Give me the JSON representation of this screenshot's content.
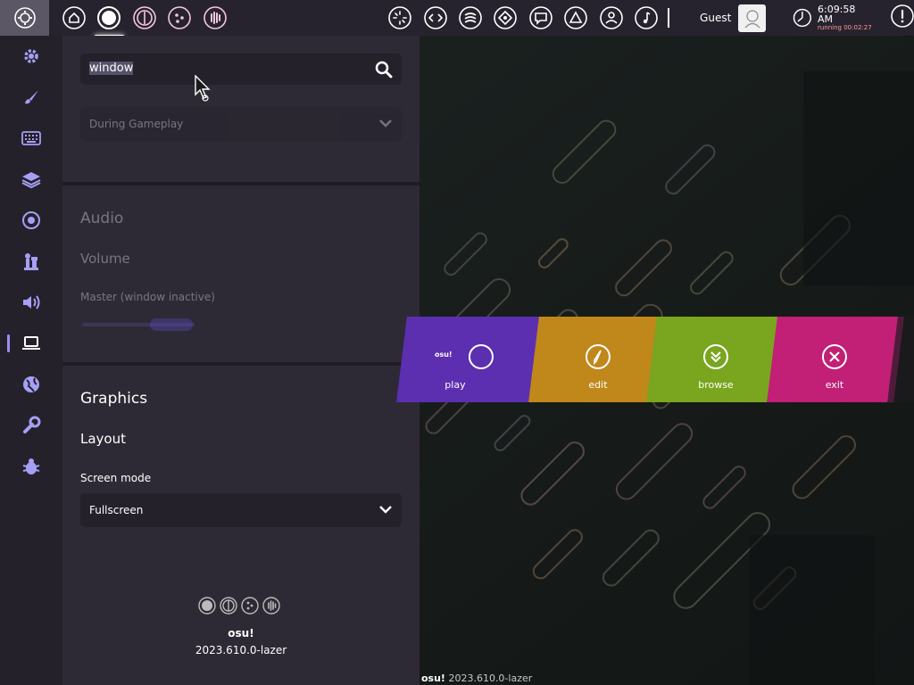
{
  "toolbar": {
    "ruleset_icons": [
      "ruleset-osu-icon",
      "ruleset-taiko-icon",
      "ruleset-catch-icon",
      "ruleset-mania-icon"
    ],
    "right_icons": [
      "news-icon",
      "changelog-icon",
      "rankings-icon",
      "beatmap-listing-icon",
      "chat-icon",
      "social-icon",
      "dashboard-icon",
      "music-icon"
    ],
    "user_name": "Guest",
    "clock_time": "6:09:58 AM",
    "clock_running": "running 00:02:27"
  },
  "sidebar": {
    "items": [
      "general",
      "skin",
      "input",
      "user-interface",
      "gameplay",
      "rulesets",
      "audio",
      "graphics",
      "online",
      "maintenance",
      "debug"
    ],
    "active": "graphics"
  },
  "search": {
    "query": "window"
  },
  "sections": {
    "dropdown1_value": "During Gameplay",
    "audio_title": "Audio",
    "volume_title": "Volume",
    "master_inactive_label": "Master (window inactive)",
    "graphics_title": "Graphics",
    "layout_title": "Layout",
    "screen_mode_label": "Screen mode",
    "screen_mode_value": "Fullscreen"
  },
  "footer": {
    "brand": "osu!",
    "version": "2023.610.0-lazer"
  },
  "main_menu": {
    "play": "play",
    "play_icon_text": "osu!",
    "edit": "edit",
    "browse": "browse",
    "exit": "exit"
  },
  "bottom_version": {
    "brand": "osu!",
    "version": "2023.610.0-lazer"
  },
  "colors": {
    "accent": "#9d8df1",
    "play": "#5b2fb0",
    "edit": "#c0871a",
    "browse": "#79a51f",
    "exit": "#c21f76"
  }
}
